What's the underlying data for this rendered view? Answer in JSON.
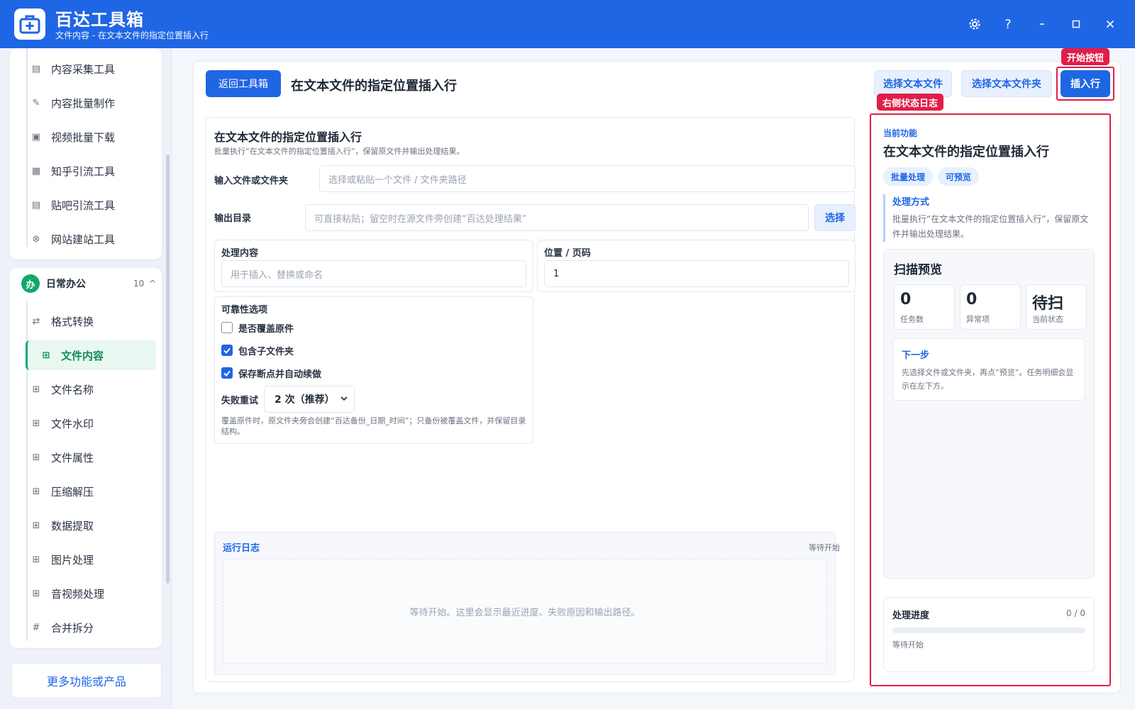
{
  "app": {
    "title": "百达工具箱",
    "subtitle": "文件内容 - 在文本文件的指定位置插入行",
    "logo_icon": "medkit-icon"
  },
  "window_controls": [
    "gear-icon",
    "help-icon",
    "minimize-icon",
    "maximize-icon",
    "close-icon"
  ],
  "sidebar": {
    "top_items": [
      {
        "label": "内容采集工具",
        "icon": "collect-icon"
      },
      {
        "label": "内容批量制作",
        "icon": "pen-icon"
      },
      {
        "label": "视频批量下载",
        "icon": "video-icon"
      },
      {
        "label": "知乎引流工具",
        "icon": "zhihu-icon"
      },
      {
        "label": "贴吧引流工具",
        "icon": "tieba-icon"
      },
      {
        "label": "网站建站工具",
        "icon": "web-icon"
      }
    ],
    "group": {
      "badge": "办",
      "title": "日常办公",
      "count": "10",
      "chevron": "^"
    },
    "group_items": [
      {
        "label": "格式转换",
        "icon": "swap-icon"
      },
      {
        "label": "文件内容",
        "icon": "grid-icon",
        "active": true
      },
      {
        "label": "文件名称",
        "icon": "grid-icon"
      },
      {
        "label": "文件水印",
        "icon": "grid-icon"
      },
      {
        "label": "文件属性",
        "icon": "grid-icon"
      },
      {
        "label": "压缩解压",
        "icon": "grid-icon"
      },
      {
        "label": "数据提取",
        "icon": "grid-icon"
      },
      {
        "label": "图片处理",
        "icon": "grid-icon"
      },
      {
        "label": "音视频处理",
        "icon": "grid-icon"
      },
      {
        "label": "合并拆分",
        "icon": "hash-icon"
      }
    ],
    "more": "更多功能或产品"
  },
  "toolbar": {
    "back": "返回工具箱",
    "title": "在文本文件的指定位置插入行",
    "select_file": "选择文本文件",
    "select_folder": "选择文本文件夹",
    "insert": "插入行",
    "tag_start": "开始按钮",
    "tag_log": "右侧状态日志"
  },
  "form": {
    "title": "在文本文件的指定位置插入行",
    "desc": "批量执行“在文本文件的指定位置插入行”，保留原文件并输出处理结果。",
    "input_label": "输入文件或文件夹",
    "input_placeholder": "选择或粘贴一个文件 / 文件夹路径",
    "output_label": "输出目录",
    "output_placeholder": "可直接粘贴；留空时在源文件旁创建“百达处理结果”",
    "select_btn": "选择",
    "content_label": "处理内容",
    "content_placeholder": "用于插入、替换或命名",
    "position_label": "位置 / 页码",
    "position_value": "1",
    "reliability_title": "可靠性选项",
    "options": [
      {
        "label": "是否覆盖原件",
        "checked": false
      },
      {
        "label": "包含子文件夹",
        "checked": true
      },
      {
        "label": "保存断点并自动续做",
        "checked": true
      }
    ],
    "retry_label": "失败重试",
    "retry_value": "2 次（推荐）",
    "note": "覆盖原件时，原文件夹旁会创建“百达备份_日期_时间”；只备份被覆盖文件，并保留目录结构。"
  },
  "log": {
    "title": "运行日志",
    "status": "等待开始",
    "empty": "等待开始。这里会显示最近进度、失败原因和输出路径。"
  },
  "right_panel": {
    "caption": "当前功能",
    "title": "在文本文件的指定位置插入行",
    "tags": [
      "批量处理",
      "可预览"
    ],
    "method_title": "处理方式",
    "method_desc": "批量执行“在文本文件的指定位置插入行”，保留原文件并输出处理结果。",
    "scan_title": "扫描预览",
    "stats": [
      {
        "value": "0",
        "label": "任务数"
      },
      {
        "value": "0",
        "label": "异常项"
      },
      {
        "value": "待扫",
        "label": "当前状态"
      }
    ],
    "next_title": "下一步",
    "next_desc": "先选择文件或文件夹，再点“预览”。任务明细会显示在左下方。",
    "progress_title": "处理进度",
    "progress_count": "0 / 0",
    "progress_fraction": 0,
    "progress_status": "等待开始"
  },
  "colors": {
    "primary": "#1f66e5",
    "accent_green": "#10a86b",
    "highlight_red": "#e11d48"
  }
}
